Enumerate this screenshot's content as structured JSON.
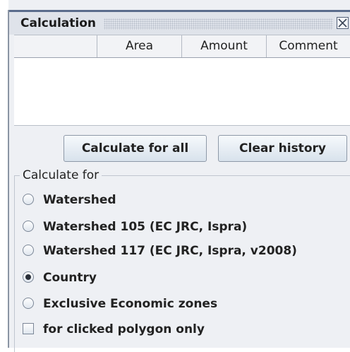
{
  "window": {
    "title": "Calculation"
  },
  "table": {
    "columns": [
      "",
      "Area",
      "Amount",
      "Comment"
    ],
    "rows": []
  },
  "buttons": {
    "calculate_all": "Calculate for all",
    "clear_history": "Clear history"
  },
  "calculate_for": {
    "label": "Calculate for",
    "options": [
      {
        "label": "Watershed",
        "selected": false
      },
      {
        "label": "Watershed 105 (EC JRC, Ispra)",
        "selected": false
      },
      {
        "label": "Watershed 117 (EC JRC, Ispra, v2008)",
        "selected": false
      },
      {
        "label": "Country",
        "selected": true
      },
      {
        "label": "Exclusive Economic zones",
        "selected": false
      }
    ],
    "checkbox": {
      "label": "for clicked polygon only",
      "checked": false
    }
  },
  "icons": {
    "close": "close-icon"
  },
  "colors": {
    "title_bar": "#dfe3ea",
    "panel": "#eef0f4",
    "frame": "#5a6c8c"
  }
}
